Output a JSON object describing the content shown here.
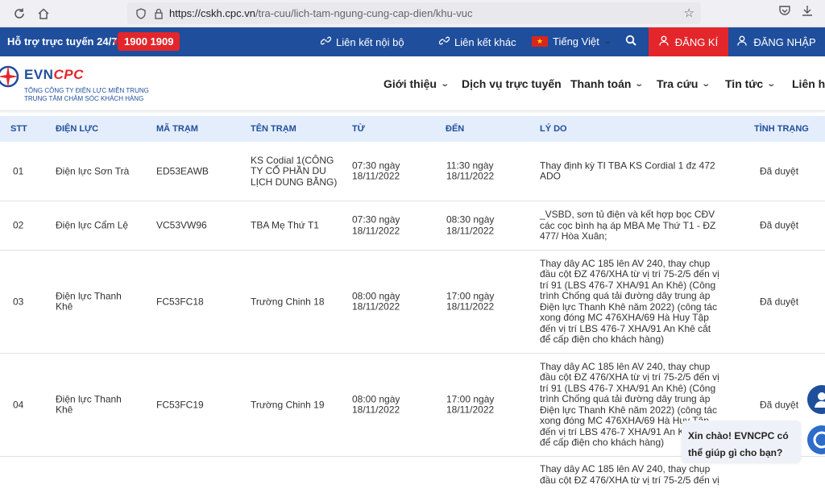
{
  "browser": {
    "url_host": "https://cskh.cpc.vn",
    "url_path": "/tra-cuu/lich-tam-ngung-cung-cap-dien/khu-vuc"
  },
  "topbar": {
    "support_label": "Hỗ trợ trực tuyến 24/7:",
    "hotline": "1900 1909",
    "internal_link": "Liên kết nội bộ",
    "other_link": "Liên kết khác",
    "language": "Tiếng Việt",
    "register": "ĐĂNG KÍ",
    "login": "ĐĂNG NHẬP"
  },
  "logo": {
    "evn": "EVN",
    "cpc": "CPC",
    "sub1": "TỔNG CÔNG TY ĐIỆN LỰC MIỀN TRUNG",
    "sub2": "TRUNG TÂM CHĂM SÓC KHÁCH HÀNG"
  },
  "menu": [
    "Giới thiệu",
    "Dịch vụ trực tuyến",
    "Thanh toán",
    "Tra cứu",
    "Tin tức",
    "Liên hệ"
  ],
  "table": {
    "headers": [
      "STT",
      "ĐIỆN LỰC",
      "MÃ TRẠM",
      "TÊN TRẠM",
      "TỪ",
      "ĐẾN",
      "LÝ DO",
      "TÌNH TRẠNG"
    ],
    "rows": [
      {
        "stt": "01",
        "dien_luc": "Điện lực Sơn Trà",
        "ma_tram": "ED53EAWB",
        "ten_tram": "KS Codial 1(CÔNG TY CỔ PHẦN DU LỊCH DUNG BẰNG)",
        "tu": "07:30 ngày 18/11/2022",
        "den": "11:30 ngày 18/11/2022",
        "ly_do": "Thay định kỳ TI TBA KS Cordial 1 đz 472 ADO",
        "tinh_trang": "Đã duyệt"
      },
      {
        "stt": "02",
        "dien_luc": "Điện lực Cẩm Lệ",
        "ma_tram": "VC53VW96",
        "ten_tram": "TBA Mẹ Thứ T1",
        "tu": "07:30 ngày 18/11/2022",
        "den": "08:30 ngày 18/11/2022",
        "ly_do": "_VSBD, sơn tủ điện và kết hợp bọc CĐV các cọc bình hạ áp MBA Mẹ Thứ T1 - ĐZ 477/ Hòa Xuân;",
        "tinh_trang": "Đã duyệt"
      },
      {
        "stt": "03",
        "dien_luc": "Điện lực Thanh Khê",
        "ma_tram": "FC53FC18",
        "ten_tram": "Trường Chinh 18",
        "tu": "08:00 ngày 18/11/2022",
        "den": "17:00 ngày 18/11/2022",
        "ly_do": "Thay dây AC 185 lên AV 240, thay chụp đầu cột ĐZ 476/XHA từ vị trí 75-2/5 đến vị trí 91 (LBS 476-7 XHA/91 An Khê) (Công trình Chống quá tải đường dây trung áp Điện lực Thanh Khê năm 2022) (công tác xong đóng MC 476XHA/69 Hà Huy Tập đến vị trí LBS 476-7 XHA/91 An Khê cắt để cấp điện cho khách hàng)",
        "tinh_trang": "Đã duyệt"
      },
      {
        "stt": "04",
        "dien_luc": "Điện lực Thanh Khê",
        "ma_tram": "FC53FC19",
        "ten_tram": "Trường Chinh 19",
        "tu": "08:00 ngày 18/11/2022",
        "den": "17:00 ngày 18/11/2022",
        "ly_do": "Thay dây AC 185 lên AV 240, thay chụp đầu cột ĐZ 476/XHA từ vị trí 75-2/5 đến vị trí 91 (LBS 476-7 XHA/91 An Khê) (Công trình Chống quá tải đường dây trung áp Điện lực Thanh Khê năm 2022) (công tác xong đóng MC 476XHA/69 Hà Huy Tập đến vị trí LBS 476-7 XHA/91 An Khê cắt để cấp điện cho khách hàng)",
        "tinh_trang": "Đã duyệt"
      },
      {
        "stt": "",
        "dien_luc": "",
        "ma_tram": "",
        "ten_tram": "",
        "tu": "",
        "den": "",
        "ly_do": "Thay dây AC 185 lên AV 240, thay chụp đầu cột ĐZ 476/XHA từ vị trí 75-2/5 đến vị",
        "tinh_trang": ""
      }
    ]
  },
  "chat": {
    "greeting": "Xin chào! EVNCPC có thể giúp gì cho bạn?"
  }
}
